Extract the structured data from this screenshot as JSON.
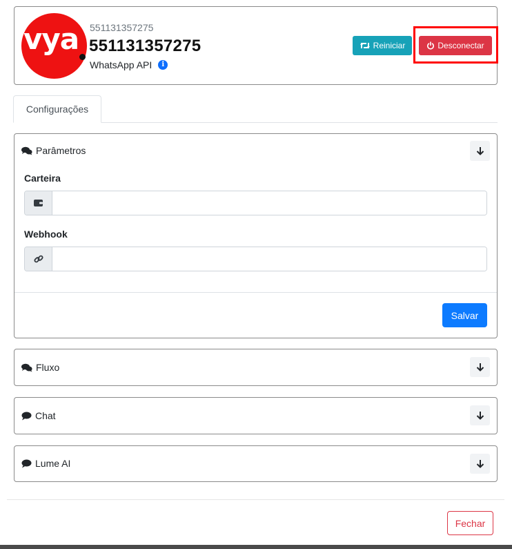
{
  "header": {
    "logo_text": "vya",
    "phone_small": "551131357275",
    "phone_big": "551131357275",
    "api_label": "WhatsApp API",
    "info_icon": "info-circle-icon",
    "restart_label": "Reiniciar",
    "restart_icon": "retweet-icon",
    "disconnect_label": "Desconectar",
    "disconnect_icon": "power-icon"
  },
  "tabs": [
    {
      "label": "Configurações",
      "active": true
    }
  ],
  "sections": {
    "parametros": {
      "title": "Parâmetros",
      "icon": "comments-icon",
      "expanded": true,
      "fields": {
        "carteira": {
          "label": "Carteira",
          "icon": "wallet-icon",
          "value": ""
        },
        "webhook": {
          "label": "Webhook",
          "icon": "link-icon",
          "value": ""
        }
      },
      "save_label": "Salvar"
    },
    "fluxo": {
      "title": "Fluxo",
      "icon": "comments-icon",
      "expanded": false
    },
    "chat": {
      "title": "Chat",
      "icon": "comment-icon",
      "expanded": false
    },
    "lume": {
      "title": "Lume AI",
      "icon": "comment-icon",
      "expanded": false
    }
  },
  "footer": {
    "close_label": "Fechar"
  },
  "colors": {
    "logo_red": "#ee1212",
    "teal": "#17a2b8",
    "danger": "#dc3545",
    "primary": "#0d7bff",
    "highlight": "#ff0000"
  }
}
